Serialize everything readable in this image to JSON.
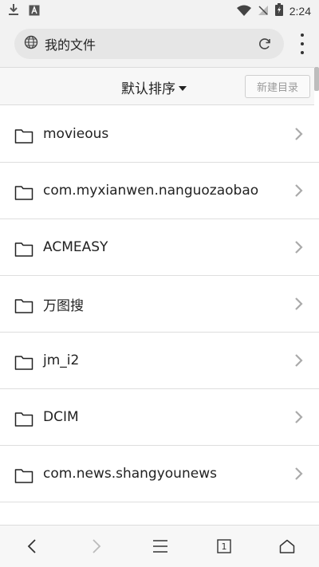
{
  "status_bar": {
    "time": "2:24",
    "icons": [
      "download-icon",
      "a-icon",
      "wifi-icon",
      "signal-off-icon",
      "battery-charging-icon"
    ]
  },
  "address_bar": {
    "url_text": "我的文件",
    "icons": [
      "globe-icon",
      "reload-icon",
      "more-menu-icon"
    ]
  },
  "toolbar": {
    "sort_label": "默认排序",
    "new_dir_label": "新建目录"
  },
  "files": [
    {
      "name": "movieous"
    },
    {
      "name": "com.myxianwen.nanguozaobao"
    },
    {
      "name": "ACMEASY"
    },
    {
      "name": "万图搜"
    },
    {
      "name": "jm_i2"
    },
    {
      "name": "DCIM"
    },
    {
      "name": "com.news.shangyounews"
    }
  ],
  "bottom_nav": {
    "tab_count": "1",
    "icons": [
      "back-icon",
      "forward-icon",
      "menu-icon",
      "tabs-icon",
      "home-icon"
    ]
  },
  "colors": {
    "bar_bg": "#f2f2f2",
    "pill_bg": "#e6e6e6",
    "divider": "#dedede",
    "disabled_text": "#9a9a9a"
  }
}
